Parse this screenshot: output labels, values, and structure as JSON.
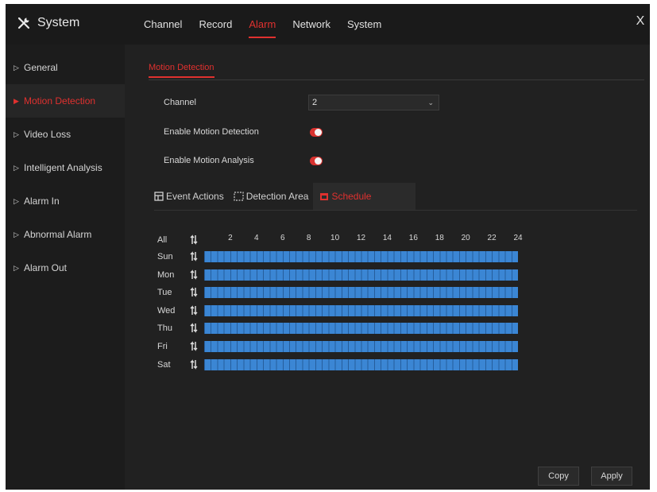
{
  "app": {
    "title": "System",
    "close": "X"
  },
  "nav": {
    "tabs": [
      "Channel",
      "Record",
      "Alarm",
      "Network",
      "System"
    ],
    "active": "Alarm"
  },
  "sidebar": {
    "items": [
      {
        "label": "General"
      },
      {
        "label": "Motion Detection",
        "active": true
      },
      {
        "label": "Video Loss"
      },
      {
        "label": "Intelligent Analysis"
      },
      {
        "label": "Alarm In"
      },
      {
        "label": "Abnormal Alarm"
      },
      {
        "label": "Alarm Out"
      }
    ]
  },
  "main": {
    "subtab": "Motion Detection",
    "channel_label": "Channel",
    "channel_value": "2",
    "enable_motion_label": "Enable Motion Detection",
    "enable_motion_on": true,
    "enable_analysis_label": "Enable Motion Analysis",
    "enable_analysis_on": true,
    "section_tabs": [
      "Event Actions",
      "Detection Area",
      "Schedule"
    ],
    "active_section": "Schedule"
  },
  "schedule": {
    "all_label": "All",
    "hours": [
      "2",
      "4",
      "6",
      "8",
      "10",
      "12",
      "14",
      "16",
      "18",
      "20",
      "22",
      "24"
    ],
    "days": [
      "Sun",
      "Mon",
      "Tue",
      "Wed",
      "Thu",
      "Fri",
      "Sat"
    ],
    "fill_fraction": 1.0
  },
  "buttons": {
    "copy": "Copy",
    "apply": "Apply"
  },
  "colors": {
    "accent": "#e0312f",
    "schedule": "#3b86d4",
    "background": "#1e1e1e"
  }
}
